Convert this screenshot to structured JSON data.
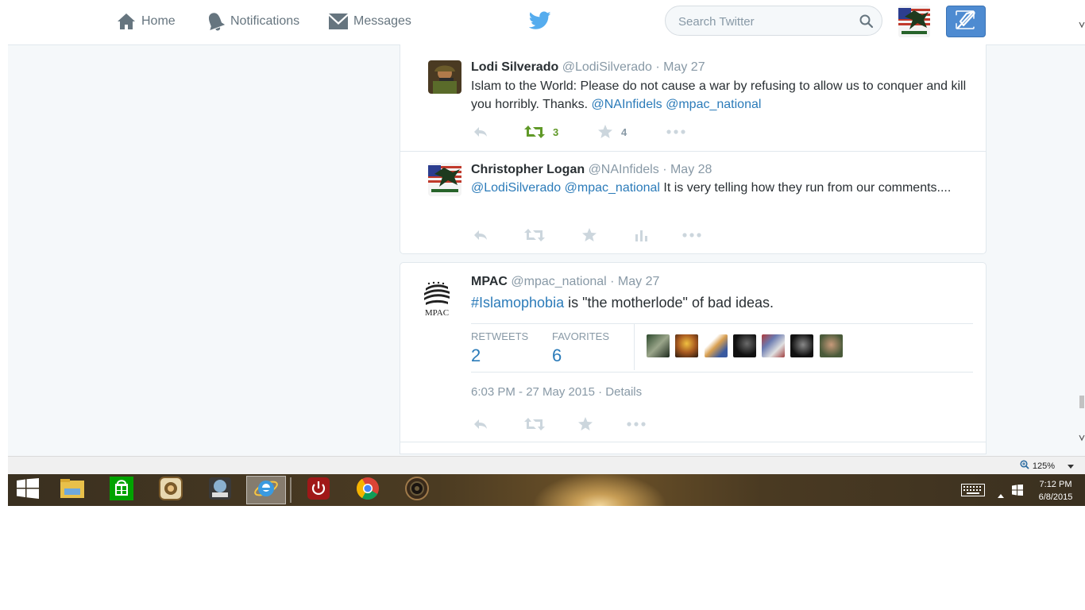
{
  "nav": {
    "home": "Home",
    "notifications": "Notifications",
    "messages": "Messages",
    "search_placeholder": "Search Twitter"
  },
  "thread": [
    {
      "name": "Lodi Silverado",
      "handle": "@LodiSilverado",
      "date": "· May 27",
      "text_plain": "Islam to the World: Please do not cause a war by refusing to allow us to conquer and kill you horribly. Thanks. ",
      "mention1": "@NAInfidels",
      "mention2": "@mpac_national",
      "retweets": "3",
      "favorites": "4"
    },
    {
      "name": "Christopher Logan",
      "handle": "@NAInfidels",
      "date": "· May 28",
      "mention1": "@LodiSilverado",
      "mention2": "@mpac_national",
      "text_plain": " It is very telling how they run from our comments...."
    }
  ],
  "main_tweet": {
    "name": "MPAC",
    "handle": "@mpac_national",
    "date": "· May 27",
    "hashtag": "#Islamophobia",
    "text_rest": " is \"the motherlode\" of bad ideas.",
    "avatar_text": "MPAC",
    "retweets_label": "RETWEETS",
    "retweets_value": "2",
    "favorites_label": "FAVORITES",
    "favorites_value": "6",
    "timestamp": "6:03 PM - 27 May 2015",
    "details": "Details"
  },
  "browser": {
    "zoom": "125%"
  },
  "taskbar": {
    "time": "7:12 PM",
    "date": "6/8/2015"
  },
  "colors": {
    "link": "#2b7bb9",
    "retweeted": "#609928",
    "compose": "#4e8bd1"
  }
}
